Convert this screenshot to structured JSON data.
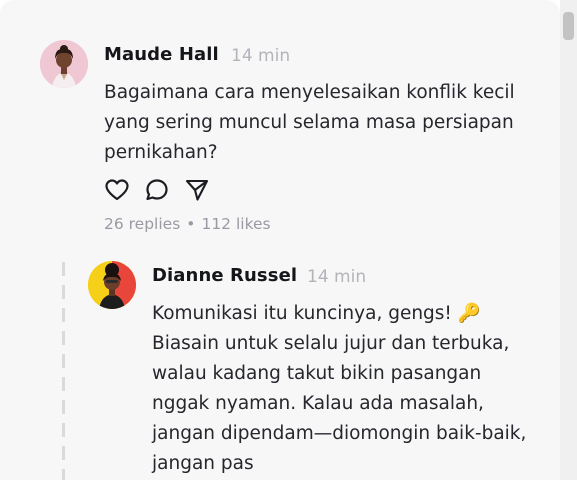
{
  "thread": {
    "post": {
      "author": "Maude Hall",
      "time": "14 min",
      "text": "Bagaimana cara menyelesaikan konflik kecil yang sering muncul selama masa persiapan pernikahan?",
      "replies": "26 replies",
      "separator": "•",
      "likes": "112 likes"
    },
    "reply": {
      "author": "Dianne Russel",
      "time": "14 min",
      "text": "Komunikasi itu kuncinya, gengs! 🔑 Biasain untuk selalu jujur dan terbuka, walau kadang takut bikin pasangan nggak nyaman. Kalau ada masalah, jangan dipendam—diomongin baik-baik, jangan pas"
    }
  },
  "colors": {
    "panel": "#f7f7f8",
    "text": "#26272c",
    "muted": "#9a9aa2",
    "time": "#b3b3ba"
  },
  "icons": [
    "heart-icon",
    "comment-icon",
    "send-icon"
  ]
}
